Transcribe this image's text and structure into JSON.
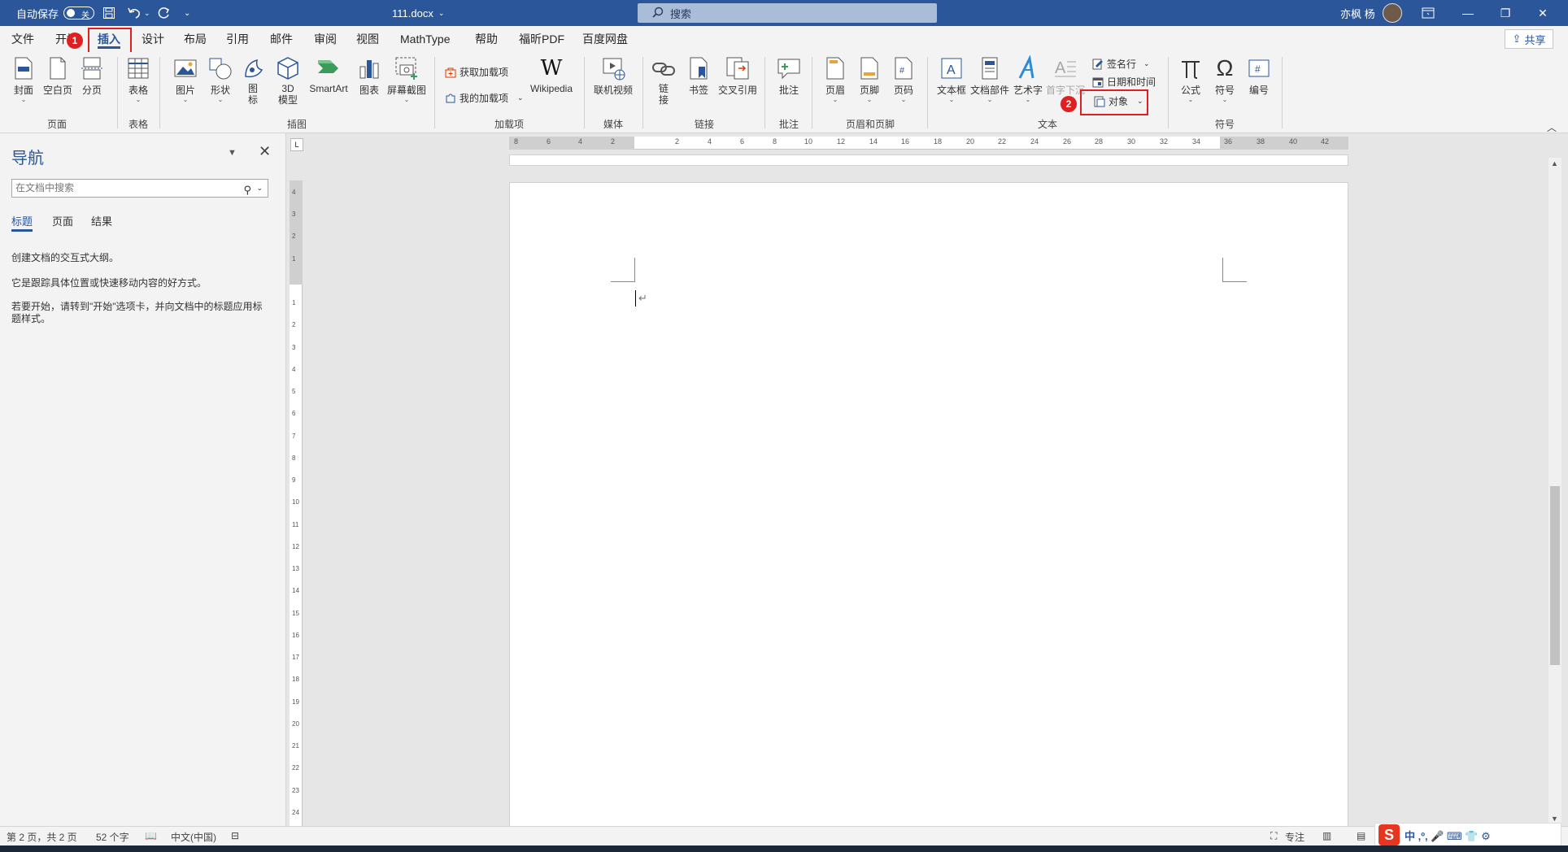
{
  "titlebar": {
    "autosave_label": "自动保存",
    "autosave_state": "关",
    "doc_title": "111.docx",
    "title_caret": "⌄",
    "search_placeholder": "搜索",
    "user_name": "亦枫 杨",
    "colors": {
      "bar": "#2b579a"
    }
  },
  "tabs": [
    {
      "label": "文件"
    },
    {
      "label": "开始"
    },
    {
      "label": "插入",
      "active": true
    },
    {
      "label": "设计"
    },
    {
      "label": "布局"
    },
    {
      "label": "引用"
    },
    {
      "label": "邮件"
    },
    {
      "label": "审阅"
    },
    {
      "label": "视图"
    },
    {
      "label": "MathType"
    },
    {
      "label": "帮助"
    },
    {
      "label": "福昕PDF"
    },
    {
      "label": "百度网盘"
    }
  ],
  "share_label": "共享",
  "annotations": {
    "step1": "1",
    "step2": "2",
    "highlight_color": "#e02020"
  },
  "ribbon": {
    "pages": {
      "cover": "封面",
      "blank": "空白页",
      "break": "分页",
      "group": "页面"
    },
    "table": {
      "table": "表格",
      "group": "表格"
    },
    "illustrations": {
      "picture": "图片",
      "shapes": "形状",
      "icons": "图标",
      "model3d": "3D模型",
      "smartart": "SmartArt",
      "chart": "图表",
      "screenshot": "屏幕截图",
      "group": "插图"
    },
    "addins": {
      "get": "获取加载项",
      "mine": "我的加载项",
      "wiki": "Wikipedia",
      "group": "加载项"
    },
    "media": {
      "video": "联机视频",
      "group": "媒体"
    },
    "links": {
      "link": "链接",
      "bookmark": "书签",
      "crossref": "交叉引用",
      "group": "链接"
    },
    "comments": {
      "comment": "批注",
      "group": "批注"
    },
    "headerfooter": {
      "header": "页眉",
      "footer": "页脚",
      "pagenum": "页码",
      "group": "页眉和页脚"
    },
    "text": {
      "textbox": "文本框",
      "parts": "文档部件",
      "wordart": "艺术字",
      "dropcap": "首字下沉",
      "signature": "签名行",
      "datetime": "日期和时间",
      "object": "对象",
      "group": "文本"
    },
    "symbols": {
      "equation": "公式",
      "symbol": "符号",
      "number": "编号",
      "group": "符号"
    }
  },
  "nav": {
    "title": "导航",
    "search_placeholder": "在文档中搜索",
    "tabs": [
      "标题",
      "页面",
      "结果"
    ],
    "text1": "创建文档的交互式大纲。",
    "text2": "它是跟踪具体位置或快速移动内容的好方式。",
    "text3": "若要开始，请转到\"开始\"选项卡，并向文档中的标题应用标题样式。"
  },
  "ruler": {
    "h_ticks": [
      "8",
      "6",
      "4",
      "2",
      "",
      "2",
      "4",
      "6",
      "8",
      "10",
      "12",
      "14",
      "16",
      "18",
      "20",
      "22",
      "24",
      "26",
      "28",
      "30",
      "32",
      "34",
      "36",
      "38",
      "40",
      "42"
    ],
    "v_ticks": [
      "4",
      "3",
      "2",
      "1",
      "",
      "1",
      "2",
      "3",
      "4",
      "5",
      "6",
      "7",
      "8",
      "9",
      "10",
      "11",
      "12",
      "13",
      "14",
      "15",
      "16",
      "17",
      "18",
      "19",
      "20",
      "21",
      "22",
      "23",
      "24"
    ],
    "corner": "L"
  },
  "status": {
    "page": "第 2 页，共 2 页",
    "words": "52 个字",
    "lang": "中文(中国)",
    "focus": "专注"
  },
  "ime": {
    "logo": "S",
    "text": "中 ,º, 🎤 ⌨ 👕 ⚙"
  }
}
